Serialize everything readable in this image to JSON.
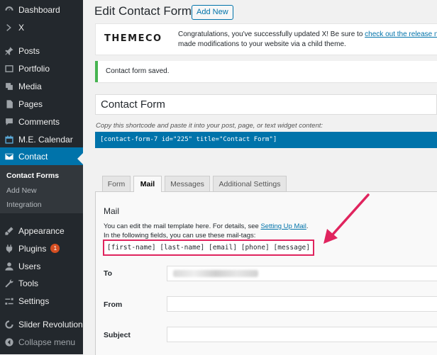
{
  "sidebar": {
    "items": [
      {
        "label": "Dashboard",
        "icon": "dashboard-icon"
      },
      {
        "label": "X",
        "icon": "chevron-right-icon"
      },
      {
        "label": "Posts",
        "icon": "pin-icon"
      },
      {
        "label": "Portfolio",
        "icon": "portfolio-icon"
      },
      {
        "label": "Media",
        "icon": "media-icon"
      },
      {
        "label": "Pages",
        "icon": "pages-icon"
      },
      {
        "label": "Comments",
        "icon": "comments-icon"
      },
      {
        "label": "M.E. Calendar",
        "icon": "calendar-icon"
      },
      {
        "label": "Contact",
        "icon": "mail-icon"
      },
      {
        "label": "Appearance",
        "icon": "appearance-icon"
      },
      {
        "label": "Plugins",
        "icon": "plugins-icon",
        "badge": "1"
      },
      {
        "label": "Users",
        "icon": "users-icon"
      },
      {
        "label": "Tools",
        "icon": "tools-icon"
      },
      {
        "label": "Settings",
        "icon": "settings-icon"
      },
      {
        "label": "Slider Revolution",
        "icon": "slider-icon"
      },
      {
        "label": "Collapse menu",
        "icon": "collapse-icon"
      }
    ],
    "submenu": [
      "Contact Forms",
      "Add New",
      "Integration"
    ]
  },
  "header": {
    "title": "Edit Contact Form",
    "add_new": "Add New"
  },
  "themeco_notice": {
    "logo": "THEMECO",
    "text_before": "Congratulations, you've successfully updated X! Be sure to ",
    "link": "check out the release not",
    "line2": "made modifications to your website via a child theme."
  },
  "saved_notice": "Contact form saved.",
  "form_title": "Contact Form",
  "shortcode_label": "Copy this shortcode and paste it into your post, page, or text widget content:",
  "shortcode": "[contact-form-7 id=\"225\" title=\"Contact Form\"]",
  "tabs": [
    "Form",
    "Mail",
    "Messages",
    "Additional Settings"
  ],
  "mail_panel": {
    "heading": "Mail",
    "desc_before": "You can edit the mail template here. For details, see ",
    "desc_link": "Setting Up Mail",
    "desc_after": ".",
    "tags_intro": "In the following fields, you can use these mail-tags:",
    "tags": "[first-name] [last-name] [email] [phone] [message]",
    "fields": [
      {
        "label": "To"
      },
      {
        "label": "From"
      },
      {
        "label": "Subject"
      }
    ]
  },
  "colors": {
    "sidebar": "#23282d",
    "accent": "#0073aa",
    "highlight": "#e0245e",
    "success": "#46b450"
  }
}
